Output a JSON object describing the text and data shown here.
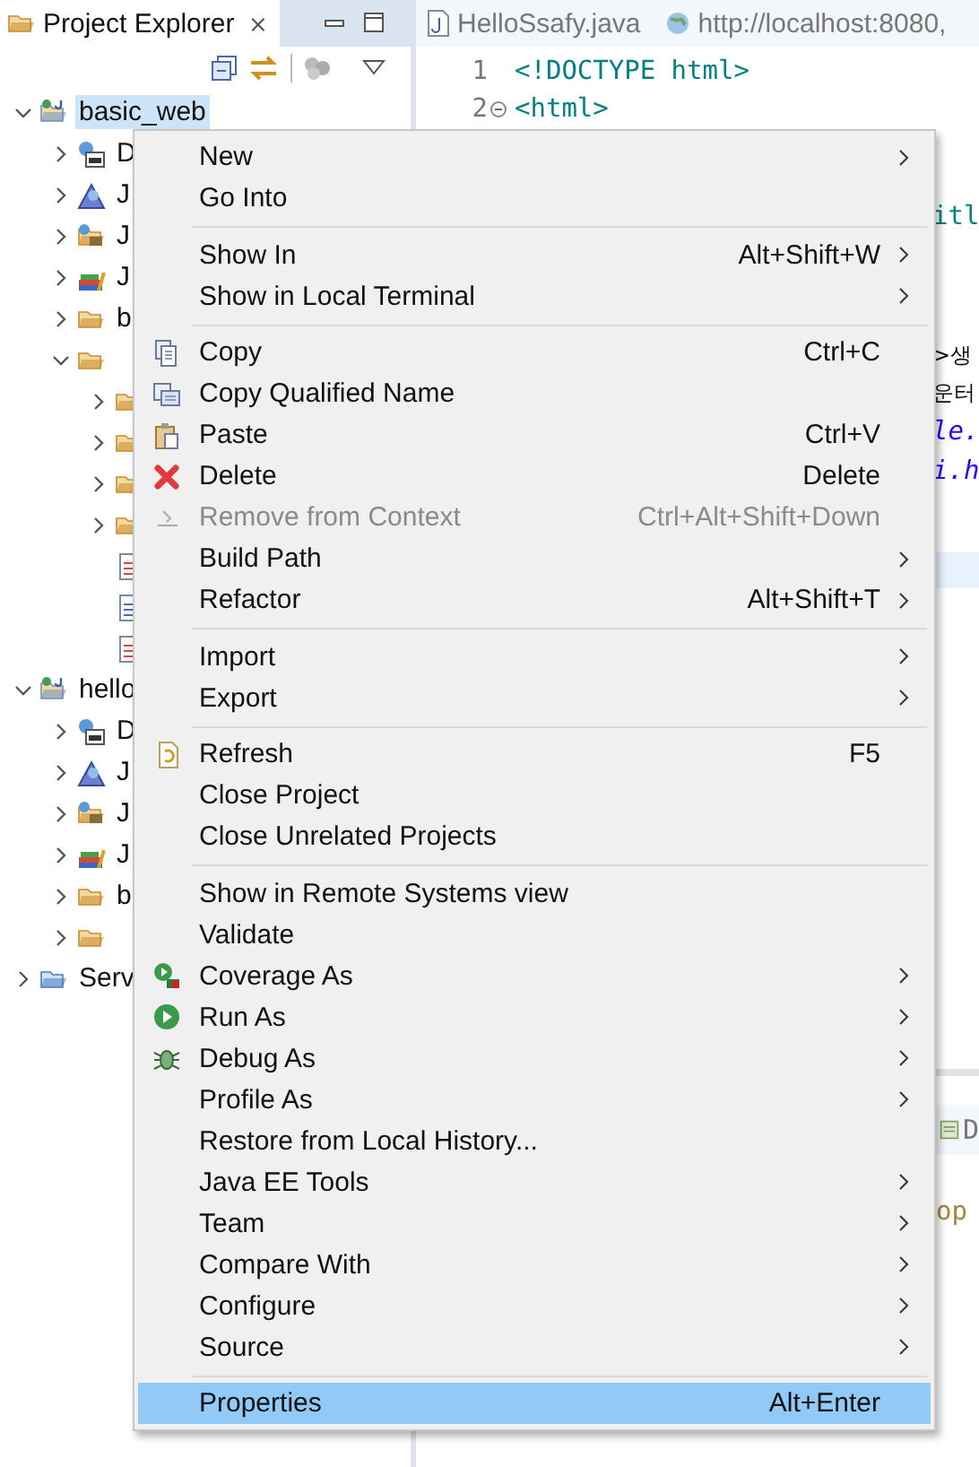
{
  "explorer": {
    "title": "Project Explorer",
    "close": "⨯",
    "tree": [
      {
        "label": "basic_web",
        "kind": "project",
        "expanded": true,
        "selected": true,
        "children": [
          {
            "label": "D",
            "kind": "descriptor",
            "expanded": false,
            "selected": false
          },
          {
            "label": "J",
            "kind": "webservice",
            "expanded": false,
            "selected": false
          },
          {
            "label": "J",
            "kind": "resources",
            "expanded": false,
            "selected": false
          },
          {
            "label": "J",
            "kind": "libraries",
            "expanded": false,
            "selected": false
          },
          {
            "label": "b",
            "kind": "folder",
            "expanded": false,
            "selected": false
          },
          {
            "kind": "folder",
            "expanded": true,
            "children": [
              {
                "kind": "folder",
                "expanded": false
              },
              {
                "kind": "folder",
                "expanded": false
              },
              {
                "kind": "folder",
                "expanded": false
              },
              {
                "kind": "folder",
                "expanded": false
              },
              {
                "kind": "html-file"
              },
              {
                "kind": "text-file"
              },
              {
                "kind": "html-file"
              }
            ]
          }
        ]
      },
      {
        "label": "hello",
        "kind": "project",
        "expanded": true,
        "selected": false,
        "children": [
          {
            "label": "D",
            "kind": "descriptor",
            "expanded": false,
            "selected": false
          },
          {
            "label": "J",
            "kind": "webservice",
            "expanded": false,
            "selected": false
          },
          {
            "label": "J",
            "kind": "resources",
            "expanded": false,
            "selected": false
          },
          {
            "label": "J",
            "kind": "libraries",
            "expanded": false,
            "selected": false
          },
          {
            "label": "b",
            "kind": "folder",
            "expanded": false,
            "selected": false
          },
          {
            "kind": "folder",
            "expanded": false
          }
        ]
      },
      {
        "label": "Serv",
        "kind": "servers",
        "expanded": false,
        "selected": false
      }
    ]
  },
  "editor": {
    "tabs": [
      {
        "label": "HelloSsafy.java",
        "kind": "java"
      },
      {
        "label": "http://localhost:8080,",
        "kind": "web"
      }
    ],
    "lines": [
      {
        "number": "1",
        "text": "<!DOCTYPE html>",
        "foldable": false
      },
      {
        "number": "2",
        "text": "<html>",
        "foldable": true
      }
    ],
    "fragments": [
      {
        "text": "itl",
        "kind": "tag"
      },
      {
        "text": ">생",
        "kind": "plain"
      },
      {
        "text": "운터",
        "kind": "plain"
      },
      {
        "text": "le.",
        "kind": "italic"
      },
      {
        "text": "i.h",
        "kind": "italic"
      },
      {
        "kind": "current-line"
      }
    ],
    "panel": {
      "tab": "D",
      "text": "op"
    }
  },
  "context_menu": {
    "groups": [
      [
        {
          "label": "New",
          "kind": "plain",
          "submenu": true,
          "disabled": false,
          "selected": false
        },
        {
          "label": "Go Into",
          "kind": "plain",
          "submenu": false,
          "disabled": false,
          "selected": false
        }
      ],
      [
        {
          "label": "Show In",
          "shortcut": "Alt+Shift+W",
          "kind": "plain",
          "submenu": true,
          "disabled": false,
          "selected": false
        },
        {
          "label": "Show in Local Terminal",
          "kind": "plain",
          "submenu": true,
          "disabled": false,
          "selected": false
        }
      ],
      [
        {
          "label": "Copy",
          "shortcut": "Ctrl+C",
          "kind": "copy",
          "submenu": false,
          "disabled": false,
          "selected": false
        },
        {
          "label": "Copy Qualified Name",
          "kind": "copy-name",
          "submenu": false,
          "disabled": false,
          "selected": false
        },
        {
          "label": "Paste",
          "shortcut": "Ctrl+V",
          "kind": "paste",
          "submenu": false,
          "disabled": false,
          "selected": false
        },
        {
          "label": "Delete",
          "shortcut": "Delete",
          "kind": "delete",
          "submenu": false,
          "disabled": false,
          "selected": false
        },
        {
          "label": "Remove from Context",
          "shortcut": "Ctrl+Alt+Shift+Down",
          "kind": "remove",
          "submenu": false,
          "disabled": true,
          "selected": false
        },
        {
          "label": "Build Path",
          "kind": "plain",
          "submenu": true,
          "disabled": false,
          "selected": false
        },
        {
          "label": "Refactor",
          "shortcut": "Alt+Shift+T",
          "kind": "plain",
          "submenu": true,
          "disabled": false,
          "selected": false
        }
      ],
      [
        {
          "label": "Import",
          "kind": "plain",
          "submenu": true,
          "disabled": false,
          "selected": false
        },
        {
          "label": "Export",
          "kind": "plain",
          "submenu": true,
          "disabled": false,
          "selected": false
        }
      ],
      [
        {
          "label": "Refresh",
          "shortcut": "F5",
          "kind": "refresh",
          "submenu": false,
          "disabled": false,
          "selected": false
        },
        {
          "label": "Close Project",
          "kind": "plain",
          "submenu": false,
          "disabled": false,
          "selected": false
        },
        {
          "label": "Close Unrelated Projects",
          "kind": "plain",
          "submenu": false,
          "disabled": false,
          "selected": false
        }
      ],
      [
        {
          "label": "Show in Remote Systems view",
          "kind": "plain",
          "submenu": false,
          "disabled": false,
          "selected": false
        },
        {
          "label": "Validate",
          "kind": "plain",
          "submenu": false,
          "disabled": false,
          "selected": false
        },
        {
          "label": "Coverage As",
          "kind": "coverage",
          "submenu": true,
          "disabled": false,
          "selected": false
        },
        {
          "label": "Run As",
          "kind": "run",
          "submenu": true,
          "disabled": false,
          "selected": false
        },
        {
          "label": "Debug As",
          "kind": "debug",
          "submenu": true,
          "disabled": false,
          "selected": false
        },
        {
          "label": "Profile As",
          "kind": "plain",
          "submenu": true,
          "disabled": false,
          "selected": false
        },
        {
          "label": "Restore from Local History...",
          "kind": "plain",
          "submenu": false,
          "disabled": false,
          "selected": false
        },
        {
          "label": "Java EE Tools",
          "kind": "plain",
          "submenu": true,
          "disabled": false,
          "selected": false
        },
        {
          "label": "Team",
          "kind": "plain",
          "submenu": true,
          "disabled": false,
          "selected": false
        },
        {
          "label": "Compare With",
          "kind": "plain",
          "submenu": true,
          "disabled": false,
          "selected": false
        },
        {
          "label": "Configure",
          "kind": "plain",
          "submenu": true,
          "disabled": false,
          "selected": false
        },
        {
          "label": "Source",
          "kind": "plain",
          "submenu": true,
          "disabled": false,
          "selected": false
        }
      ],
      [
        {
          "label": "Properties",
          "shortcut": "Alt+Enter",
          "kind": "plain",
          "submenu": false,
          "disabled": false,
          "selected": true
        }
      ]
    ]
  }
}
